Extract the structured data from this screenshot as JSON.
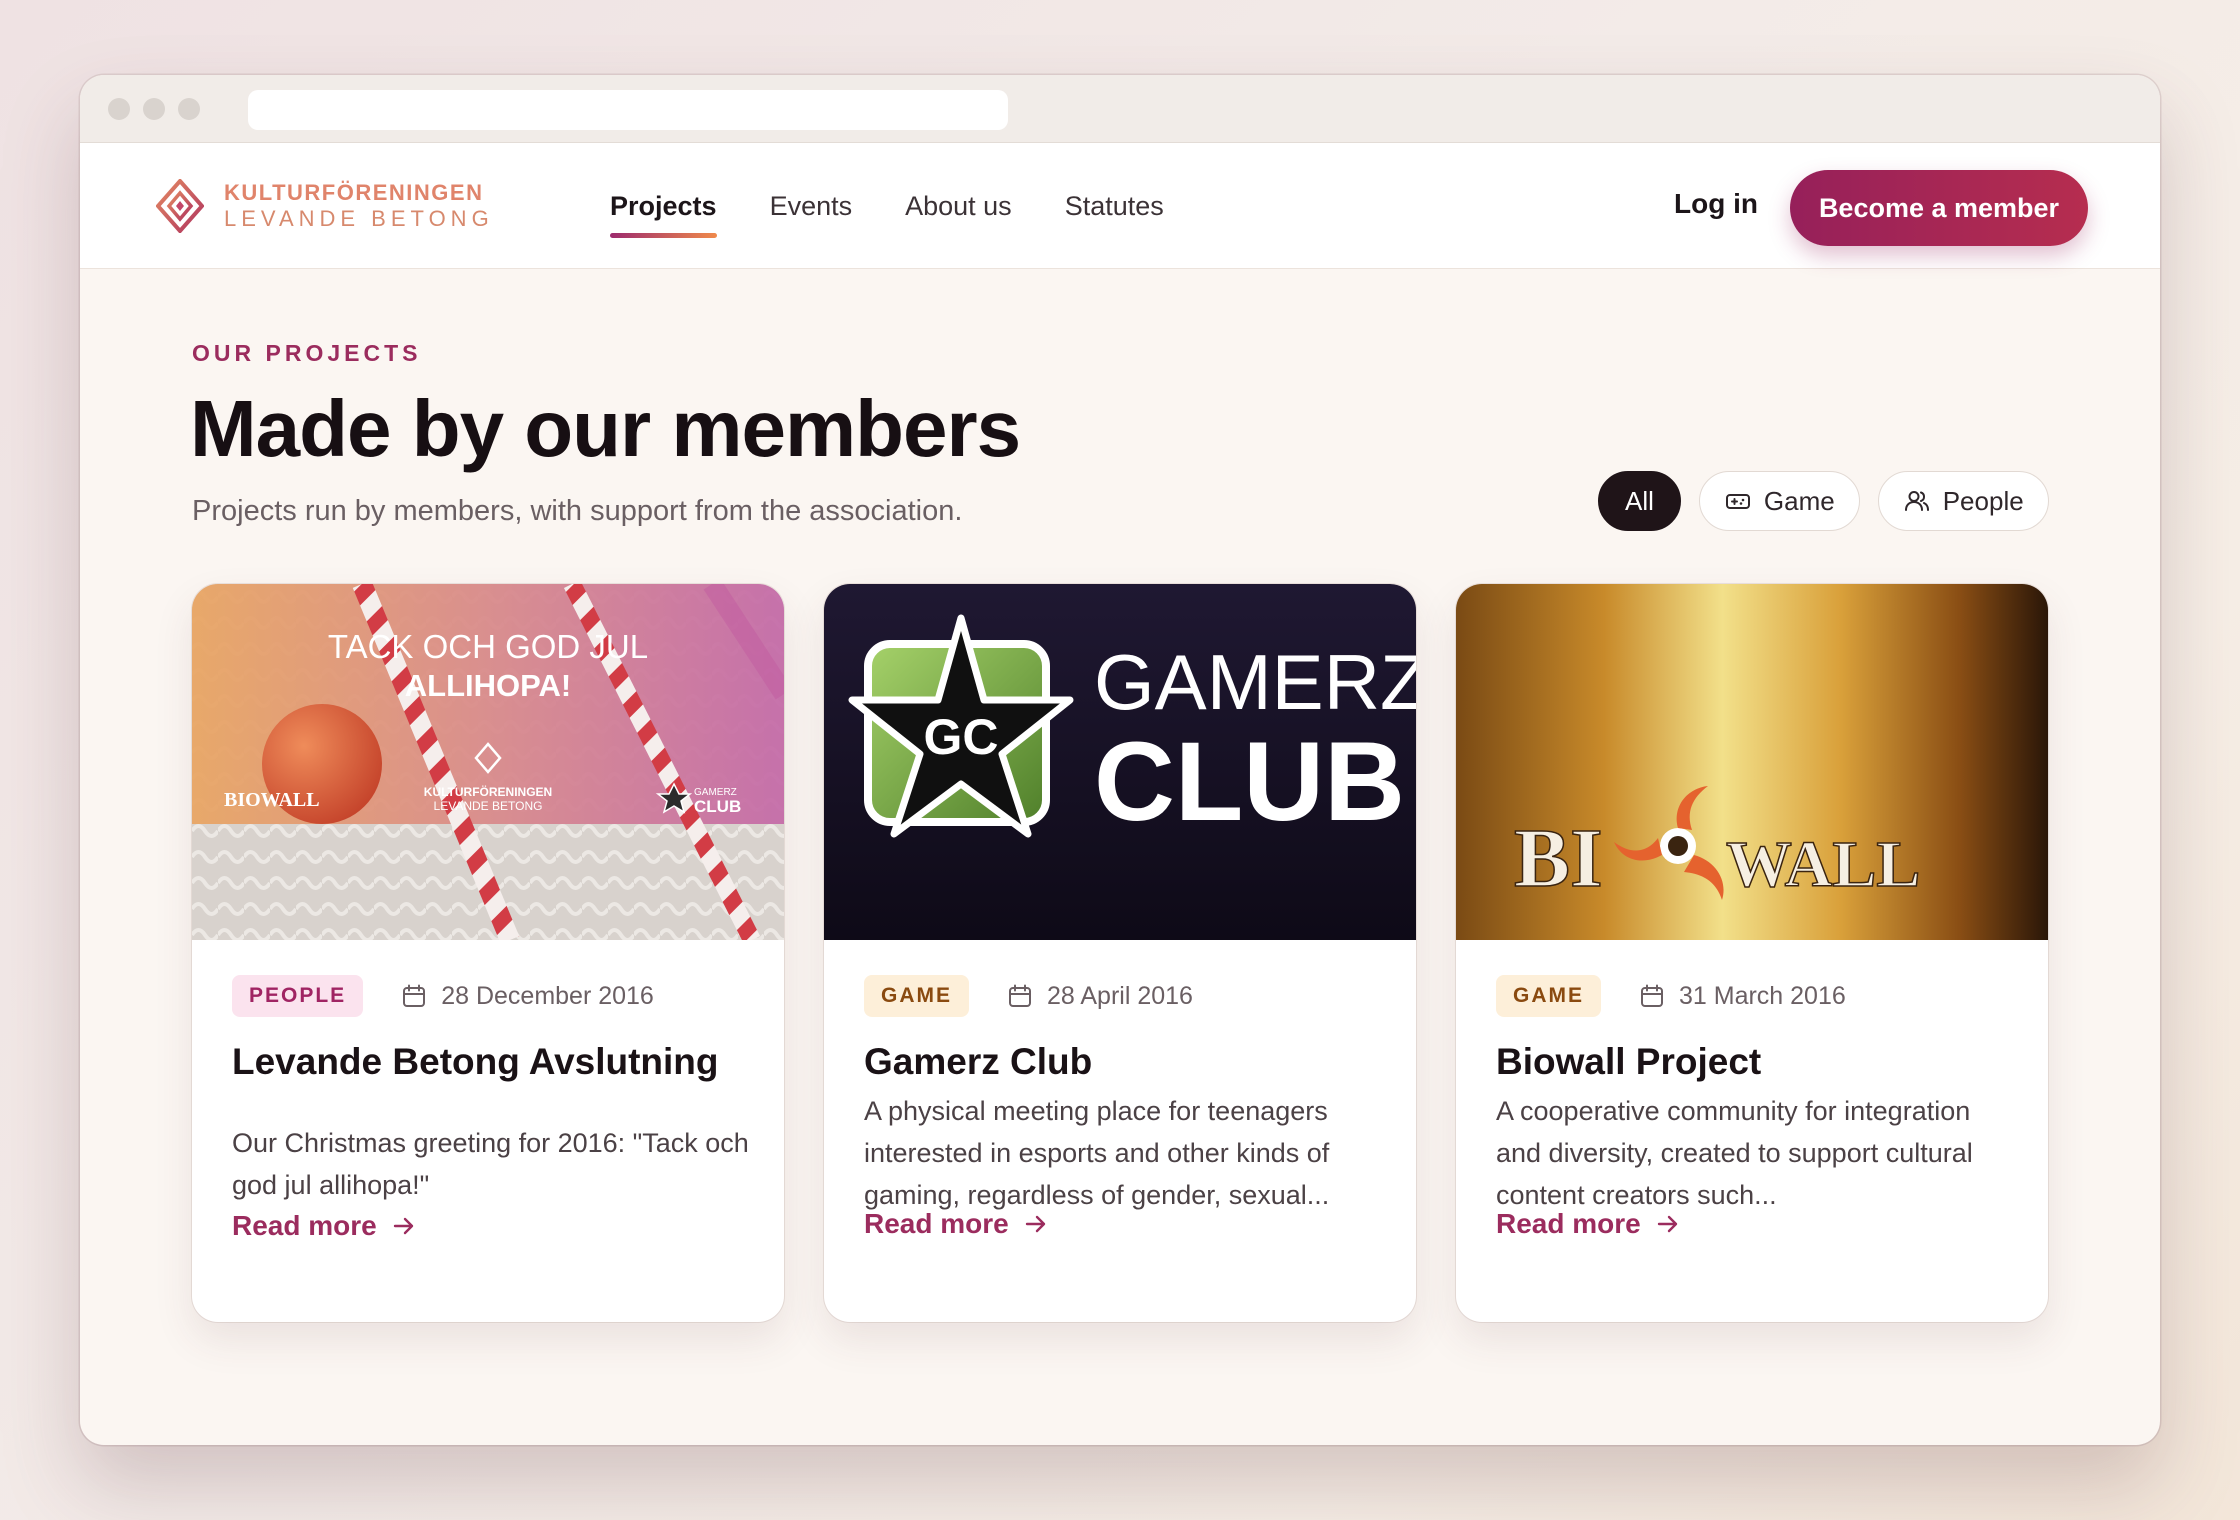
{
  "brand": {
    "line1": "KULTURFÖRENINGEN",
    "line2": "LEVANDE BETONG"
  },
  "nav": {
    "items": [
      {
        "label": "Projects",
        "active": true
      },
      {
        "label": "Events",
        "active": false
      },
      {
        "label": "About us",
        "active": false
      },
      {
        "label": "Statutes",
        "active": false
      }
    ],
    "login": "Log in",
    "cta": "Become a member"
  },
  "hero": {
    "eyebrow": "OUR PROJECTS",
    "title": "Made by our members",
    "subtitle": "Projects run by members, with support from the association."
  },
  "filters": [
    {
      "label": "All",
      "active": true,
      "icon": null
    },
    {
      "label": "Game",
      "active": false,
      "icon": "gamepad-icon"
    },
    {
      "label": "People",
      "active": false,
      "icon": "people-icon"
    }
  ],
  "cards": [
    {
      "tag": "PEOPLE",
      "date": "28 December 2016",
      "title": "Levande Betong Avslutning",
      "description": "Our Christmas greeting for 2016: \"Tack och god jul allihopa!\"",
      "link": "Read more",
      "image": {
        "line1": "TACK OCH GOD JUL",
        "line2": "ALLIHOPA!",
        "left_logo": "BIOWALL",
        "center_logo_l1": "KULTURFÖRENINGEN",
        "center_logo_l2": "LEVANDE BETONG",
        "right_logo_small": "GAMERZ",
        "right_logo_big": "CLUB"
      }
    },
    {
      "tag": "GAME",
      "date": "28 April 2016",
      "title": "Gamerz Club",
      "description": "A physical meeting place for teenagers interested in esports and other kinds of gaming, regardless of gender, sexual...",
      "link": "Read more",
      "image": {
        "emblem": "GC",
        "word1": "GAMERZ",
        "word2": "CLUB"
      }
    },
    {
      "tag": "GAME",
      "date": "31 March 2016",
      "title": "Biowall Project",
      "description": "A cooperative community for integration and diversity, created to support cultural content creators such...",
      "link": "Read more",
      "image": {
        "left": "BI",
        "right": "WALL"
      }
    }
  ],
  "colors": {
    "accent": "#9b2c5e",
    "brand_orange": "#e0846b",
    "background": "#fbf6f2"
  }
}
